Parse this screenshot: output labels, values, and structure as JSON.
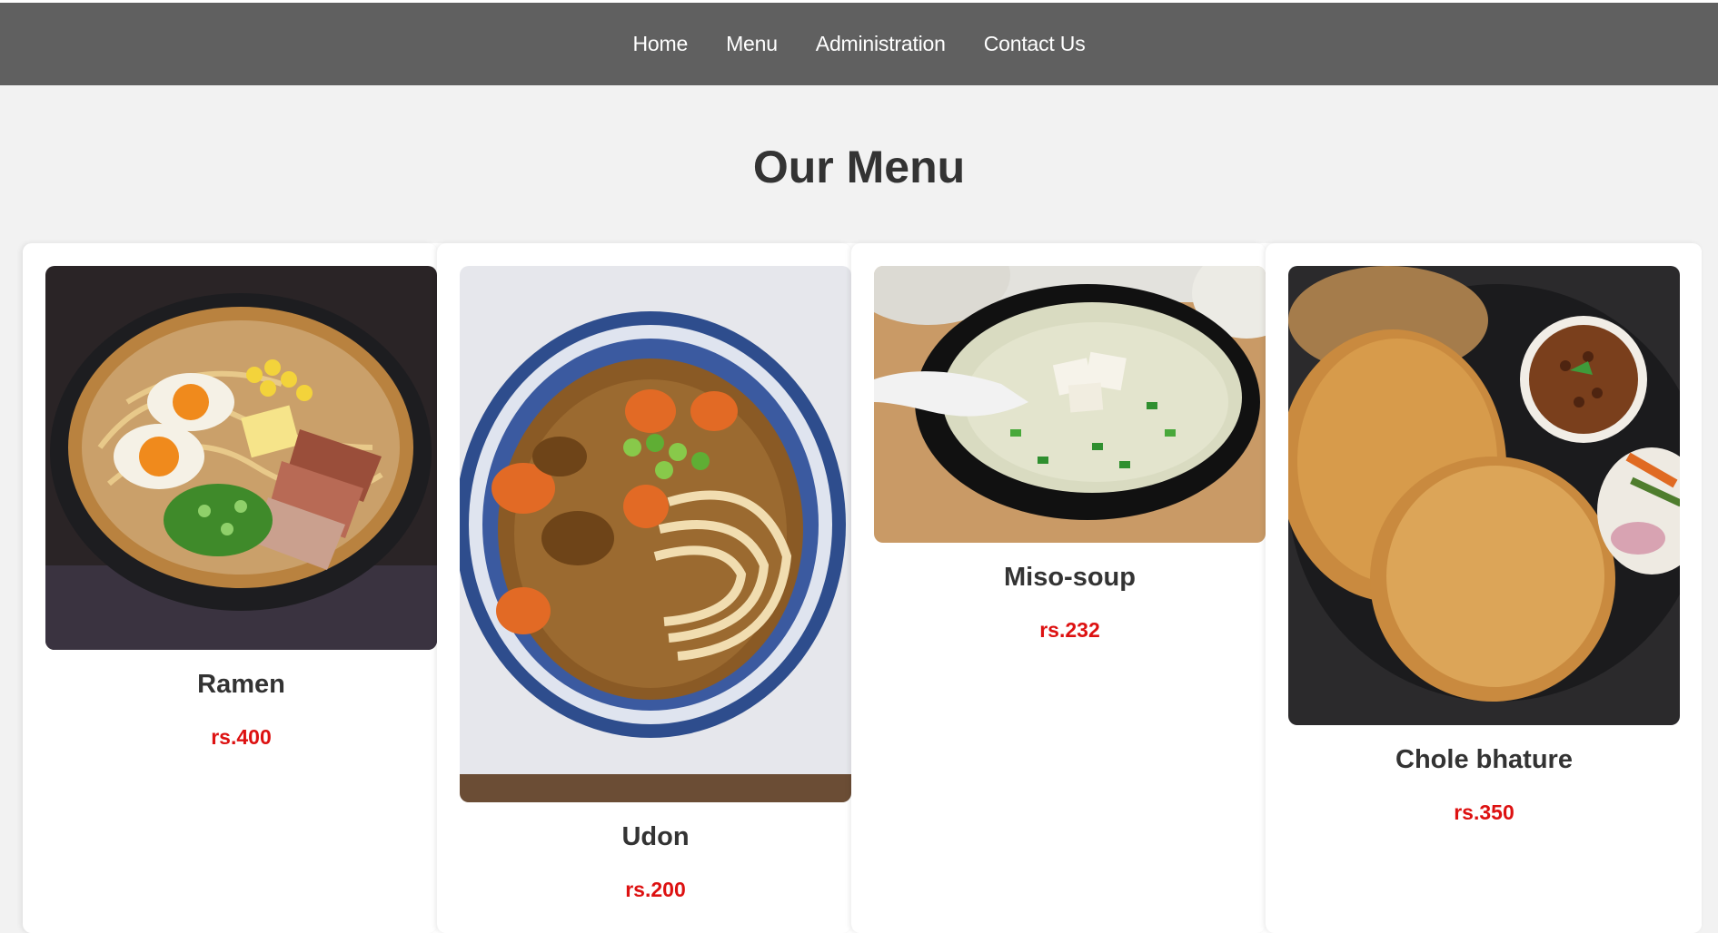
{
  "nav": {
    "items": [
      {
        "label": "Home"
      },
      {
        "label": "Menu"
      },
      {
        "label": "Administration"
      },
      {
        "label": "Contact Us"
      }
    ]
  },
  "page": {
    "title": "Our Menu"
  },
  "menu": {
    "items": [
      {
        "name": "Ramen",
        "price": "rs.400",
        "image": "ramen-bowl-photo"
      },
      {
        "name": "Udon",
        "price": "rs.200",
        "image": "udon-bowl-photo"
      },
      {
        "name": "Miso-soup",
        "price": "rs.232",
        "image": "miso-soup-photo"
      },
      {
        "name": "Chole bhature",
        "price": "rs.350",
        "image": "chole-bhature-photo"
      }
    ]
  },
  "colors": {
    "navbar_bg": "#606060",
    "page_bg": "#f2f2f2",
    "price": "#dd1111",
    "heading": "#333333"
  }
}
